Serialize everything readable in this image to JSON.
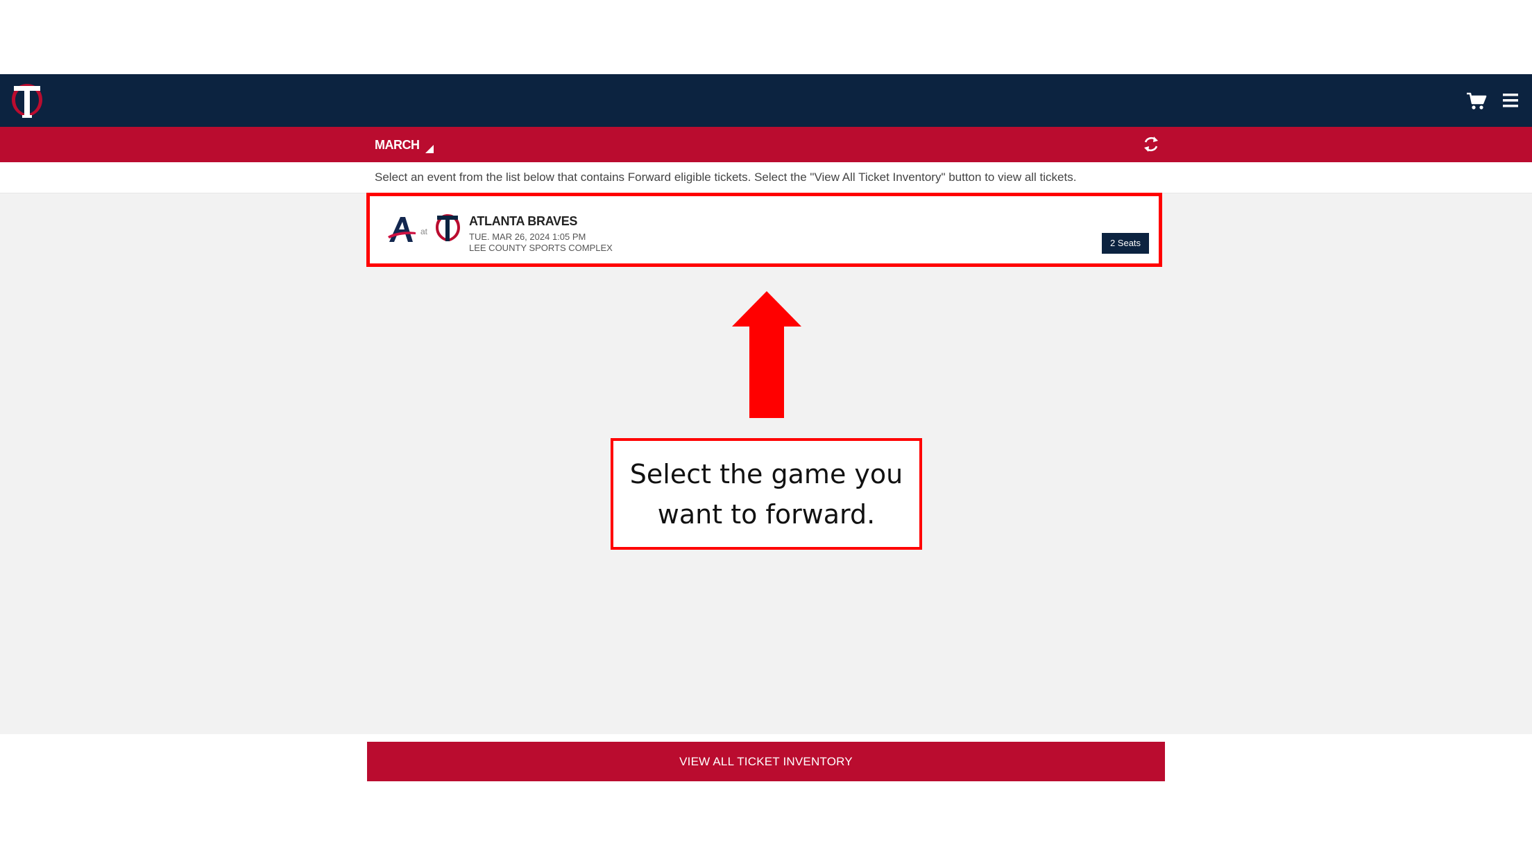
{
  "header": {
    "logo_icon": "twins-tc-logo",
    "cart_icon": "shopping-cart-icon",
    "menu_icon": "hamburger-menu-icon"
  },
  "month_bar": {
    "selected_month": "MARCH",
    "refresh_icon": "refresh-icon"
  },
  "instruction": {
    "text": "Select an event from the list below that contains Forward eligible tickets. Select the \"View All Ticket Inventory\" button to view all tickets."
  },
  "events": [
    {
      "away_team_icon": "braves-a-logo",
      "at_label": "at",
      "home_team_icon": "twins-tc-logo",
      "title": "ATLANTA BRAVES",
      "datetime": "TUE. MAR 26, 2024 1:05 PM",
      "venue": "LEE COUNTY SPORTS COMPLEX",
      "seats": "2 Seats"
    }
  ],
  "annotation": {
    "callout_text": "Select the game you want to forward."
  },
  "footer": {
    "view_all_label": "VIEW ALL TICKET INVENTORY"
  },
  "colors": {
    "navy": "#0c2340",
    "red": "#ba0c2f",
    "annotation_red": "#ff0000",
    "content_gray": "#f2f2f2"
  }
}
